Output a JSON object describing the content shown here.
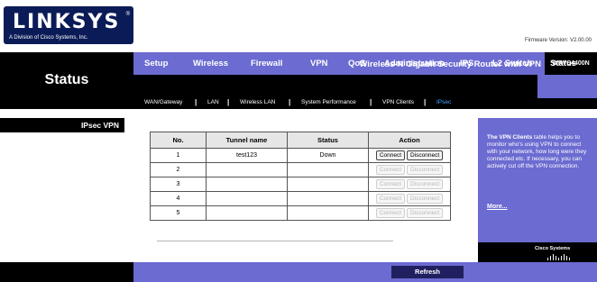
{
  "brand": {
    "logo": "LINKSYS",
    "registered": "®",
    "subtitle": "A Division of Cisco Systems, Inc.",
    "firmware": "Firmware Version: V2.00.00"
  },
  "header": {
    "section_title": "Status",
    "product_name": "Wireless-N Gigabit Security Router with VPN",
    "model": "WRVS4400N"
  },
  "nav": {
    "items": [
      "Setup",
      "Wireless",
      "Firewall",
      "VPN",
      "QoS",
      "Administration",
      "IPS",
      "L2 Switch",
      "Status"
    ],
    "active": "Status"
  },
  "subnav": {
    "items": [
      "WAN/Gateway",
      "LAN",
      "Wireless LAN",
      "System Performance",
      "VPN Clients",
      "IPsec"
    ],
    "active": "IPsec"
  },
  "left": {
    "label": "IPsec VPN"
  },
  "table": {
    "headers": [
      "No.",
      "Tunnel name",
      "Status",
      "Action"
    ],
    "rows": [
      {
        "no": "1",
        "name": "test123",
        "status": "Down",
        "enabled": true
      },
      {
        "no": "2",
        "name": "",
        "status": "",
        "enabled": false
      },
      {
        "no": "3",
        "name": "",
        "status": "",
        "enabled": false
      },
      {
        "no": "4",
        "name": "",
        "status": "",
        "enabled": false
      },
      {
        "no": "5",
        "name": "",
        "status": "",
        "enabled": false
      }
    ],
    "connect_label": "Connect",
    "disconnect_label": "Disconnect"
  },
  "help": {
    "bold": "The VPN Clients",
    "text": " table helps you to monitor who's using VPN to connect with your network, how long were they connected etc. If necessary, you can actively cut off the VPN connection.",
    "more": "More..."
  },
  "footer": {
    "refresh": "Refresh",
    "cisco": "Cisco Systems"
  },
  "colors": {
    "accent": "#6b6bd1",
    "dark": "#000000",
    "button": "#202060"
  }
}
